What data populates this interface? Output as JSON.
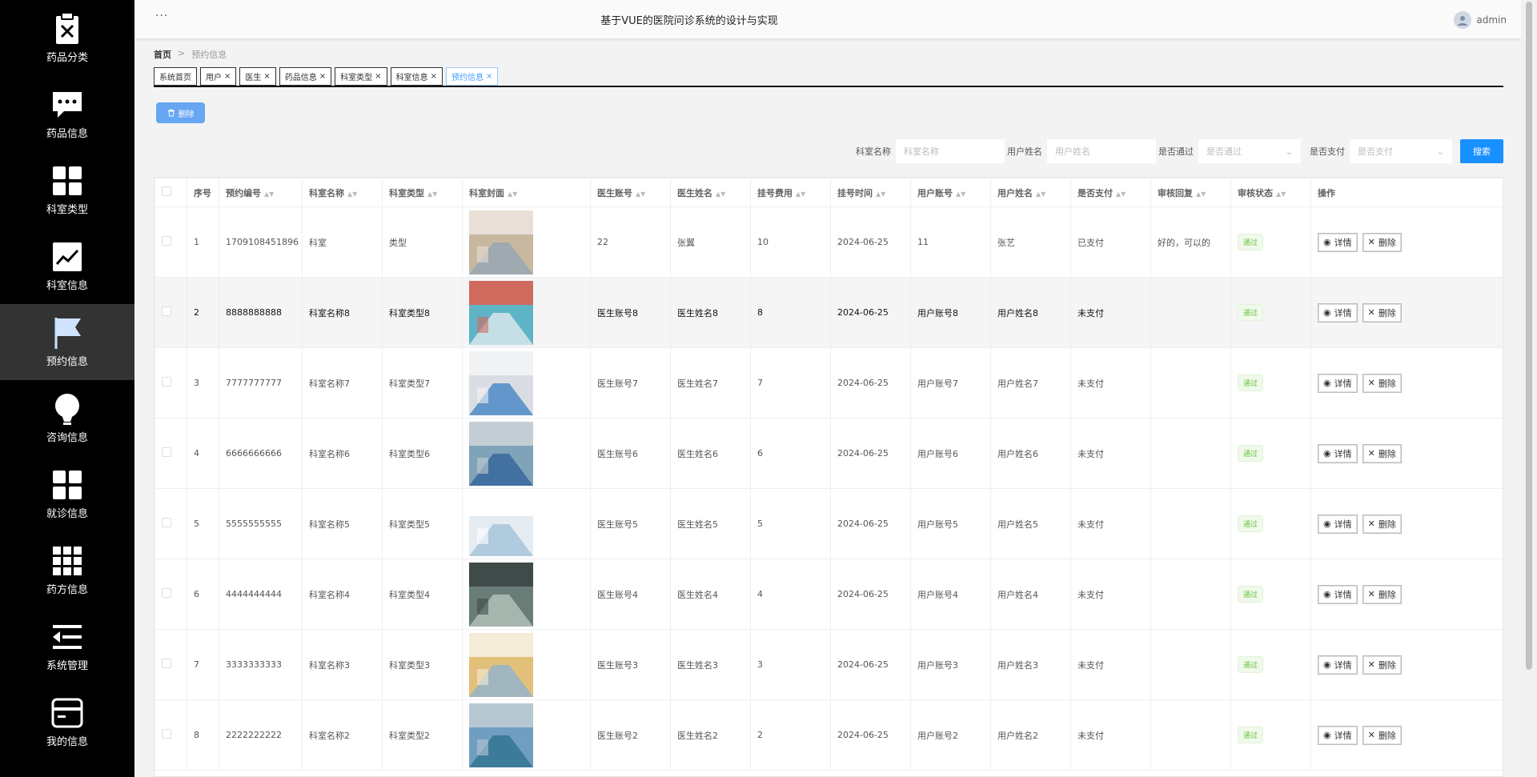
{
  "sidebar": {
    "items": [
      {
        "label": "药品分类",
        "icon": "clipboard-x-icon"
      },
      {
        "label": "药品信息",
        "icon": "chat-bubble-icon"
      },
      {
        "label": "科室类型",
        "icon": "grid-icon"
      },
      {
        "label": "科室信息",
        "icon": "line-chart-icon"
      },
      {
        "label": "预约信息",
        "icon": "flag-icon"
      },
      {
        "label": "咨询信息",
        "icon": "lightbulb-icon"
      },
      {
        "label": "就诊信息",
        "icon": "grid-icon"
      },
      {
        "label": "药方信息",
        "icon": "apps-icon"
      },
      {
        "label": "系统管理",
        "icon": "menu-back-icon"
      },
      {
        "label": "我的信息",
        "icon": "card-icon"
      }
    ],
    "active_index": 4
  },
  "header": {
    "menu_dots": "···",
    "title": "基于VUE的医院问诊系统的设计与实现",
    "username": "admin"
  },
  "breadcrumb": {
    "home": "首页",
    "separator": ">",
    "current": "预约信息"
  },
  "tabs": [
    {
      "label": "系统首页",
      "closable": false
    },
    {
      "label": "用户",
      "closable": true
    },
    {
      "label": "医生",
      "closable": true
    },
    {
      "label": "药品信息",
      "closable": true
    },
    {
      "label": "科室类型",
      "closable": true
    },
    {
      "label": "科室信息",
      "closable": true
    },
    {
      "label": "预约信息",
      "closable": true,
      "active": true
    }
  ],
  "toolbar": {
    "delete_label": "删除"
  },
  "search": {
    "dept_label": "科室名称",
    "dept_placeholder": "科室名称",
    "user_label": "用户姓名",
    "user_placeholder": "用户姓名",
    "approved_label": "是否通过",
    "approved_placeholder": "是否通过",
    "paid_label": "是否支付",
    "paid_placeholder": "是否支付",
    "button_label": "搜索"
  },
  "table": {
    "columns": [
      "序号",
      "预约编号",
      "科室名称",
      "科室类型",
      "科室封面",
      "医生账号",
      "医生姓名",
      "挂号费用",
      "挂号时间",
      "用户账号",
      "用户姓名",
      "是否支付",
      "审核回复",
      "审核状态",
      "操作"
    ],
    "detail_label": "详情",
    "delete_label": "删除",
    "rows": [
      {
        "idx": "1",
        "no": "1709108451896",
        "dept": "科室",
        "type": "类型",
        "doc_acc": "22",
        "doc_name": "张翼",
        "fee": "10",
        "time": "2024-06-25",
        "user_acc": "11",
        "user_name": "张艺",
        "paid": "已支付",
        "reply": "好的，可以的",
        "status": "通过",
        "cover_colors": [
          "#c9b8a0",
          "#8fa4b5",
          "#e8e0d6"
        ]
      },
      {
        "idx": "2",
        "no": "8888888888",
        "dept": "科室名称8",
        "type": "科室类型8",
        "doc_acc": "医生账号8",
        "doc_name": "医生姓名8",
        "fee": "8",
        "time": "2024-06-25",
        "user_acc": "用户账号8",
        "user_name": "用户姓名8",
        "paid": "未支付",
        "reply": "",
        "status": "通过",
        "cover_colors": [
          "#5fb3c6",
          "#e7eef0",
          "#d06a5e"
        ]
      },
      {
        "idx": "3",
        "no": "7777777777",
        "dept": "科室名称7",
        "type": "科室类型7",
        "doc_acc": "医生账号7",
        "doc_name": "医生姓名7",
        "fee": "7",
        "time": "2024-06-25",
        "user_acc": "用户账号7",
        "user_name": "用户姓名7",
        "paid": "未支付",
        "reply": "",
        "status": "通过",
        "cover_colors": [
          "#d9dde3",
          "#3b7fc3",
          "#f1f2f4"
        ]
      },
      {
        "idx": "4",
        "no": "6666666666",
        "dept": "科室名称6",
        "type": "科室类型6",
        "doc_acc": "医生账号6",
        "doc_name": "医生姓名6",
        "fee": "6",
        "time": "2024-06-25",
        "user_acc": "用户账号6",
        "user_name": "用户姓名6",
        "paid": "未支付",
        "reply": "",
        "status": "通过",
        "cover_colors": [
          "#7fa3b8",
          "#2e5f9a",
          "#c4cdd4"
        ]
      },
      {
        "idx": "5",
        "no": "5555555555",
        "dept": "科室名称5",
        "type": "科室类型5",
        "doc_acc": "医生账号5",
        "doc_name": "医生姓名5",
        "fee": "5",
        "time": "2024-06-25",
        "user_acc": "用户账号5",
        "user_name": "用户姓名5",
        "paid": "未支付",
        "reply": "",
        "status": "通过",
        "cover_colors": [
          "#e4ecf2",
          "#9fc0d6",
          "#ffffff"
        ]
      },
      {
        "idx": "6",
        "no": "4444444444",
        "dept": "科室名称4",
        "type": "科室类型4",
        "doc_acc": "医生账号4",
        "doc_name": "医生姓名4",
        "fee": "4",
        "time": "2024-06-25",
        "user_acc": "用户账号4",
        "user_name": "用户姓名4",
        "paid": "未支付",
        "reply": "",
        "status": "通过",
        "cover_colors": [
          "#6a7c78",
          "#b9c9c2",
          "#404a48"
        ]
      },
      {
        "idx": "7",
        "no": "3333333333",
        "dept": "科室名称3",
        "type": "科室类型3",
        "doc_acc": "医生账号3",
        "doc_name": "医生姓名3",
        "fee": "3",
        "time": "2024-06-25",
        "user_acc": "用户账号3",
        "user_name": "用户姓名3",
        "paid": "未支付",
        "reply": "",
        "status": "通过",
        "cover_colors": [
          "#e3c07a",
          "#8ab2d4",
          "#f4ecd8"
        ]
      },
      {
        "idx": "8",
        "no": "2222222222",
        "dept": "科室名称2",
        "type": "科室类型2",
        "doc_acc": "医生账号2",
        "doc_name": "医生姓名2",
        "fee": "2",
        "time": "2024-06-25",
        "user_acc": "用户账号2",
        "user_name": "用户姓名2",
        "paid": "未支付",
        "reply": "",
        "status": "通过",
        "cover_colors": [
          "#6f9ec0",
          "#2c6f8f",
          "#b8c8d2"
        ]
      }
    ]
  }
}
